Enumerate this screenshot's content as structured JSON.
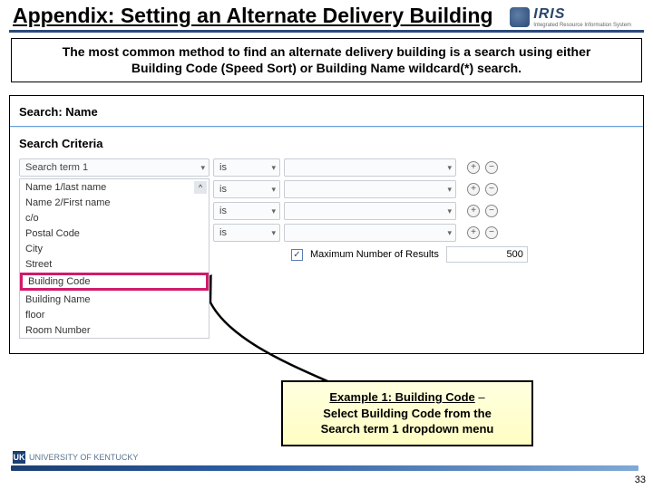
{
  "header": {
    "title": "Appendix: Setting an Alternate Delivery Building",
    "logo_text": "IRIS",
    "logo_sub": "Integrated Resource Information System"
  },
  "info_line1": "The most common method to find an alternate delivery building is a search using either",
  "info_line2": "Building Code (Speed Sort) or Building Name wildcard(*) search.",
  "search": {
    "window_title": "Search: Name",
    "criteria_label": "Search Criteria",
    "term1_label": "Search term 1",
    "op_label": "is",
    "value_placeholder": "",
    "max_label": "Maximum Number of Results",
    "max_value": "500",
    "options": {
      "o0": "Name 1/last name",
      "o1": "Name 2/First name",
      "o2": "c/o",
      "o3": "Postal Code",
      "o4": "City",
      "o5": "Street",
      "o6": "Building Code",
      "o7": "Building Name",
      "o8": "floor",
      "o9": "Room Number"
    }
  },
  "callout": {
    "line1_a": "Example 1: Building Code",
    "line1_b": " – ",
    "line2": "Select Building Code from the",
    "line3": "Search term 1 dropdown menu"
  },
  "footer": {
    "uk_abbr": "UK",
    "uk_text": "UNIVERSITY OF KENTUCKY",
    "page": "33"
  }
}
